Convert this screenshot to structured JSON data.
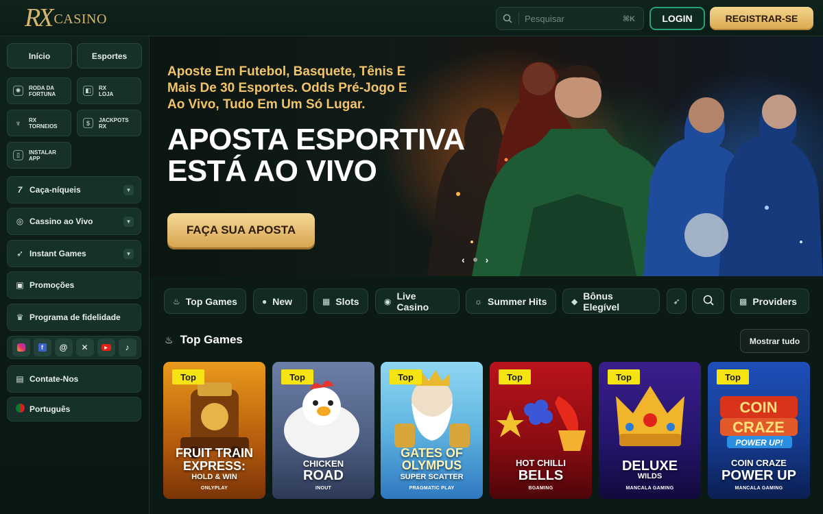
{
  "header": {
    "logo_rx": "RX",
    "logo_casino": "CASINO",
    "search_placeholder": "Pesquisar",
    "search_shortcut": "⌘K",
    "login_label": "LOGIN",
    "register_label": "REGISTRAR-SE"
  },
  "sidebar": {
    "tab_inicio": "Início",
    "tab_esportes": "Esportes",
    "tiles": [
      {
        "line1": "RODA DA",
        "line2": "FORTUNA",
        "icon": "wheel-icon"
      },
      {
        "line1": "RX",
        "line2": "LOJA",
        "icon": "bag-icon"
      },
      {
        "line1": "RX",
        "line2": "TORNEIOS",
        "icon": "trophy-icon"
      },
      {
        "line1": "JACKPOTS",
        "line2": "RX",
        "icon": "jackpot-icon"
      },
      {
        "line1": "INSTALAR",
        "line2": "APP",
        "icon": "phone-icon"
      }
    ],
    "items": [
      {
        "label": "Caça-níqueis",
        "icon": "seven-icon"
      },
      {
        "label": "Cassino ao Vivo",
        "icon": "chip-icon"
      },
      {
        "label": "Instant Games",
        "icon": "rocket-icon"
      },
      {
        "label": "Promoções",
        "icon": "gift-icon"
      },
      {
        "label": "Programa de fidelidade",
        "icon": "crown-icon"
      },
      {
        "label": "Contate-Nos",
        "icon": "chat-icon"
      },
      {
        "label": "Português",
        "icon": "portugal-flag-icon"
      }
    ],
    "socials": [
      "instagram-icon",
      "facebook-icon",
      "threads-icon",
      "x-icon",
      "youtube-icon",
      "tiktok-icon"
    ]
  },
  "hero": {
    "subtitle": "Aposte Em Futebol, Basquete, Tênis E Mais De 30 Esportes. Odds Pré-Jogo E Ao Vivo, Tudo Em Um Só Lugar.",
    "title_line1": "APOSTA ESPORTIVA",
    "title_line2": "ESTÁ AO VIVO",
    "cta_label": "FAÇA SUA APOSTA"
  },
  "categories": [
    {
      "label": "Top Games",
      "icon": "flame-icon"
    },
    {
      "label": "New",
      "icon": "new-icon"
    },
    {
      "label": "Slots",
      "icon": "slots-icon"
    },
    {
      "label": "Live Casino",
      "icon": "chip-icon"
    },
    {
      "label": "Summer Hits",
      "icon": "sun-icon"
    },
    {
      "label": "Bônus Elegível",
      "icon": "bonus-icon"
    },
    {
      "label": "",
      "icon": "rocket-icon"
    },
    {
      "label": "",
      "icon": "search-icon"
    },
    {
      "label": "Providers",
      "icon": "grid-icon"
    }
  ],
  "section": {
    "title": "Top Games",
    "show_all": "Mostrar tudo"
  },
  "games": [
    {
      "badge": "Top",
      "title1": "FRUIT TRAIN",
      "title2": "EXPRESS:",
      "title3": "HOLD & WIN",
      "provider": "ONLYPLAY"
    },
    {
      "badge": "Top",
      "title1": "CHICKEN",
      "title2": "ROAD",
      "title3": "",
      "provider": "INOUT"
    },
    {
      "badge": "Top",
      "title1": "GATES OF",
      "title2": "OLYMPUS",
      "title3": "SUPER SCATTER",
      "provider": "PRAGMATIC PLAY"
    },
    {
      "badge": "Top",
      "title1": "HOT CHILLI",
      "title2": "BELLS",
      "title3": "",
      "provider": "BGAMING"
    },
    {
      "badge": "Top",
      "title1": "DELUXE",
      "title2": "WILDS",
      "title3": "",
      "provider": "MANCALA GAMING"
    },
    {
      "badge": "Top",
      "title1": "COIN CRAZE",
      "title2": "POWER UP",
      "title3": "",
      "provider": "MANCALA GAMING"
    }
  ],
  "colors": {
    "accent_gold": "#d9a94e",
    "accent_green": "#29a07a",
    "background": "#0b1a15",
    "badge_yellow": "#f5e412"
  }
}
